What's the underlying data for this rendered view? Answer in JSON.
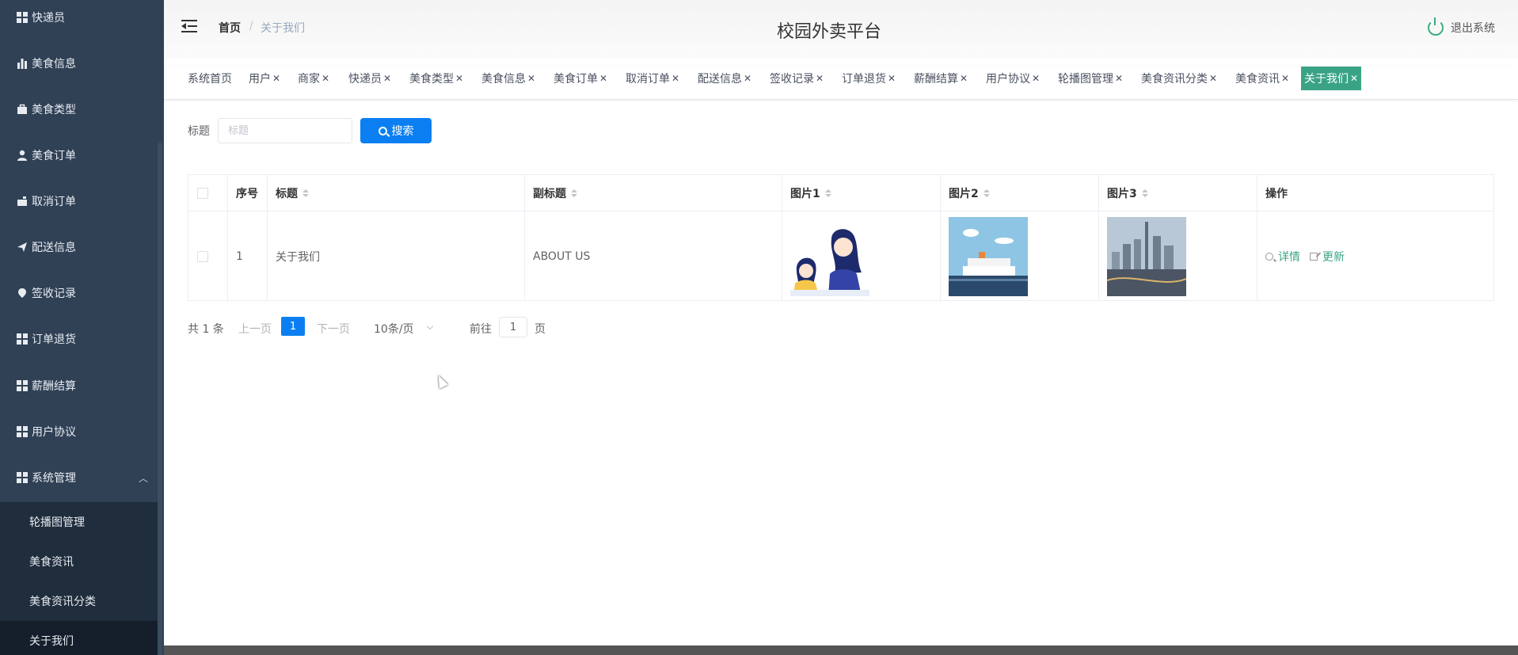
{
  "sidebar": {
    "items": [
      {
        "label": "快递员",
        "icon": "grid-icon"
      },
      {
        "label": "美食信息",
        "icon": "bar-chart-icon"
      },
      {
        "label": "美食类型",
        "icon": "briefcase-icon"
      },
      {
        "label": "美食订单",
        "icon": "user-icon"
      },
      {
        "label": "取消订单",
        "icon": "mailbox-icon"
      },
      {
        "label": "配送信息",
        "icon": "send-icon"
      },
      {
        "label": "签收记录",
        "icon": "location-icon"
      },
      {
        "label": "订单退货",
        "icon": "grid-icon"
      },
      {
        "label": "薪酬结算",
        "icon": "grid-icon"
      },
      {
        "label": "用户协议",
        "icon": "grid-icon"
      },
      {
        "label": "系统管理",
        "icon": "grid-icon"
      }
    ],
    "submenu": [
      {
        "label": "轮播图管理"
      },
      {
        "label": "美食资讯"
      },
      {
        "label": "美食资讯分类"
      },
      {
        "label": "关于我们"
      }
    ]
  },
  "header": {
    "breadcrumb_home": "首页",
    "breadcrumb_sep": "/",
    "breadcrumb_current": "关于我们",
    "title": "校园外卖平台",
    "logout_label": "退出系统"
  },
  "tags": [
    {
      "label": "系统首页",
      "closable": false
    },
    {
      "label": "用户",
      "closable": true
    },
    {
      "label": "商家",
      "closable": true
    },
    {
      "label": "快递员",
      "closable": true
    },
    {
      "label": "美食类型",
      "closable": true
    },
    {
      "label": "美食信息",
      "closable": true
    },
    {
      "label": "美食订单",
      "closable": true
    },
    {
      "label": "取消订单",
      "closable": true
    },
    {
      "label": "配送信息",
      "closable": true
    },
    {
      "label": "签收记录",
      "closable": true
    },
    {
      "label": "订单退货",
      "closable": true
    },
    {
      "label": "薪酬结算",
      "closable": true
    },
    {
      "label": "用户协议",
      "closable": true
    },
    {
      "label": "轮播图管理",
      "closable": true
    },
    {
      "label": "美食资讯分类",
      "closable": true
    },
    {
      "label": "美食资讯",
      "closable": true
    },
    {
      "label": "关于我们",
      "closable": true,
      "active": true
    }
  ],
  "close_glyph": "✕",
  "search": {
    "label": "标题",
    "placeholder": "标题",
    "button_label": "搜索"
  },
  "table": {
    "columns": [
      "序号",
      "标题",
      "副标题",
      "图片1",
      "图片2",
      "图片3",
      "操作"
    ],
    "rows": [
      {
        "index": "1",
        "title": "关于我们",
        "subtitle": "ABOUT US",
        "ops": [
          "详情",
          "更新"
        ]
      }
    ]
  },
  "pagination": {
    "total": "共 1 条",
    "prev": "上一页",
    "current": "1",
    "next": "下一页",
    "page_size": "10条/页",
    "goto": "前往",
    "goto_value": "1",
    "goto_suffix": "页"
  },
  "colors": {
    "sidebar_bg": "#304156",
    "accent": "#3aa386",
    "primary": "#0b7ff2"
  }
}
